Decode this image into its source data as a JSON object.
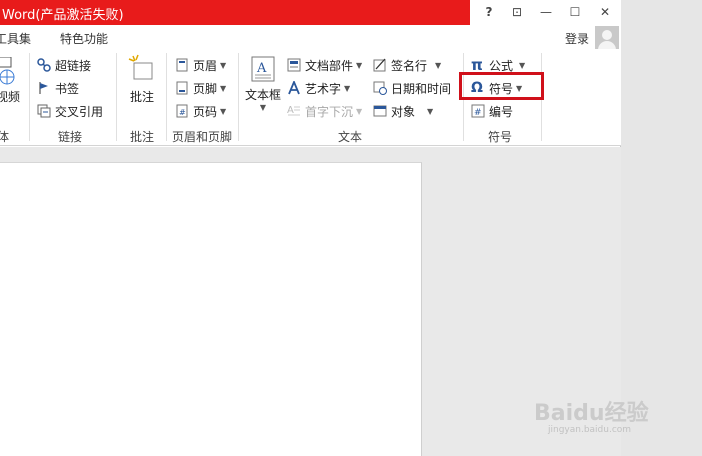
{
  "title": "Word(产品激活失败)",
  "window_controls": {
    "help": "?",
    "restore_ribbon": "⊡",
    "minimize": "—",
    "maximize": "☐",
    "close": "✕"
  },
  "menu": {
    "tabs": [
      "工具集",
      "特色功能"
    ],
    "login": "登录"
  },
  "ribbon": {
    "media": {
      "partial_label": "视频",
      "group": "体"
    },
    "links": {
      "items": [
        "超链接",
        "书签",
        "交叉引用"
      ],
      "group": "链接"
    },
    "comments": {
      "button": "批注",
      "group": "批注"
    },
    "header_footer": {
      "items": [
        "页眉",
        "页脚",
        "页码"
      ],
      "group": "页眉和页脚"
    },
    "text": {
      "textbox": "文本框",
      "items_col1": [
        "文档部件",
        "艺术字",
        "首字下沉"
      ],
      "items_col2": [
        "签名行",
        "日期和时间",
        "对象"
      ],
      "group": "文本"
    },
    "symbols": {
      "equation": "公式",
      "symbol": "符号",
      "number": "编号",
      "group": "符号",
      "equation_glyph": "π",
      "symbol_glyph": "Ω"
    }
  },
  "watermark": {
    "main": "Baidu经验",
    "sub": "jingyan.baidu.com"
  },
  "colors": {
    "title_red": "#e81b1b",
    "highlight": "#d0101a",
    "accent_blue": "#2b579a"
  }
}
